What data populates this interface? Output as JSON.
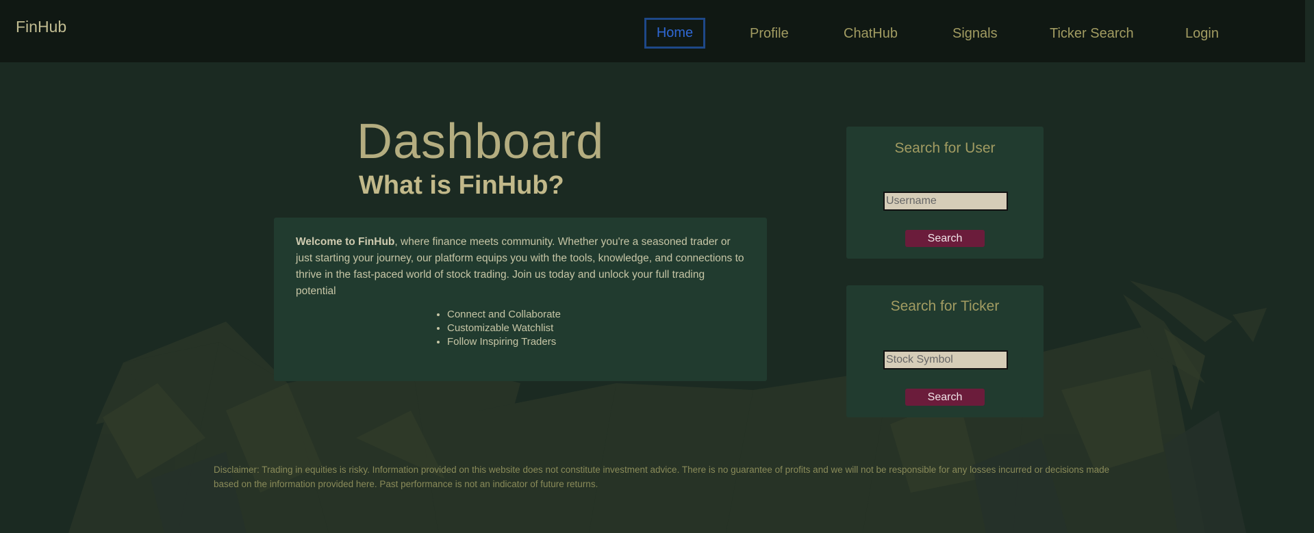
{
  "app": {
    "brand": "FinHub"
  },
  "nav": {
    "items": [
      {
        "label": "Home",
        "active": true
      },
      {
        "label": "Profile"
      },
      {
        "label": "ChatHub"
      },
      {
        "label": "Signals"
      },
      {
        "label": "Ticker Search"
      },
      {
        "label": "Login"
      }
    ]
  },
  "main": {
    "title": "Dashboard",
    "subtitle": "What is FinHub?",
    "welcome": {
      "bold": "Welcome to FinHub",
      "text": ", where finance meets community. Whether you're a seasoned trader or just starting your journey, our platform equips you with the tools, knowledge, and connections to thrive in the fast-paced world of stock trading. Join us today and unlock your full trading potential",
      "features": [
        "Connect and Collaborate",
        "Customizable Watchlist",
        "Follow Inspiring Traders"
      ]
    }
  },
  "user_search": {
    "title": "Search for User",
    "placeholder": "Username",
    "button": "Search"
  },
  "ticker_search": {
    "title": "Search for Ticker",
    "placeholder": "Stock Symbol",
    "button": "Search"
  },
  "disclaimer": "Disclaimer: Trading in equities is risky. Information provided on this website does not constitute investment advice. There is no guarantee of profits and we will not be responsible for any losses incurred or decisions made based on the information provided here. Past performance is not an indicator of future returns.",
  "colors": {
    "background": "#1b2a22",
    "navbar": "#101813",
    "card": "#213b2f",
    "accent_text": "#a29c62",
    "active_link": "#2f68d4",
    "button": "#6b1c3b"
  }
}
